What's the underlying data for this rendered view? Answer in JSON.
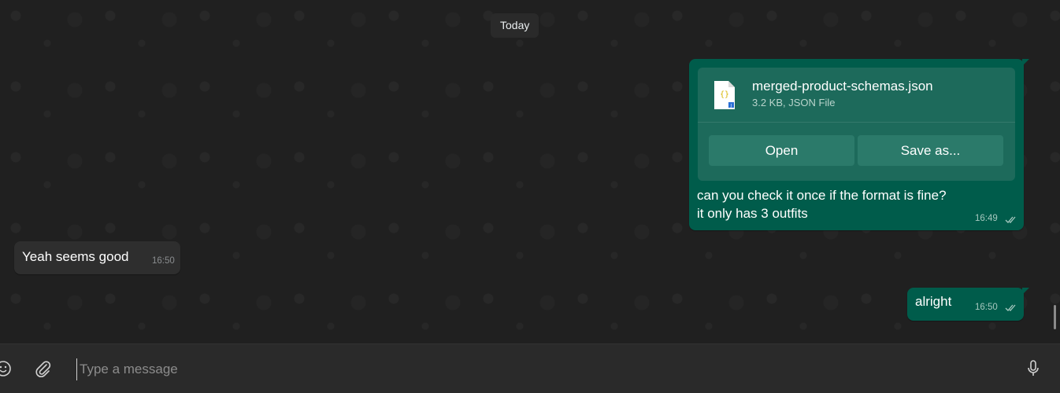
{
  "date_divider": "Today",
  "messages": {
    "file_message": {
      "file_name": "merged-product-schemas.json",
      "file_meta": "3.2 KB, JSON File",
      "open_label": "Open",
      "save_label": "Save as...",
      "text_line1": "can you check it once if the format is fine?",
      "text_line2": "it only has 3 outfits",
      "time": "16:49",
      "status_icon": "double-check-icon"
    },
    "incoming_1": {
      "text": "Yeah seems good",
      "time": "16:50"
    },
    "outgoing_2": {
      "text": "alright",
      "time": "16:50",
      "status_icon": "double-check-icon"
    }
  },
  "composer": {
    "placeholder": "Type a message",
    "value": "",
    "emoji_icon": "emoji-icon",
    "attach_icon": "paperclip-icon",
    "mic_icon": "microphone-icon"
  },
  "colors": {
    "outgoing_bubble": "#005c4b",
    "incoming_bubble": "#2e2e2e",
    "chat_background": "#202020"
  }
}
